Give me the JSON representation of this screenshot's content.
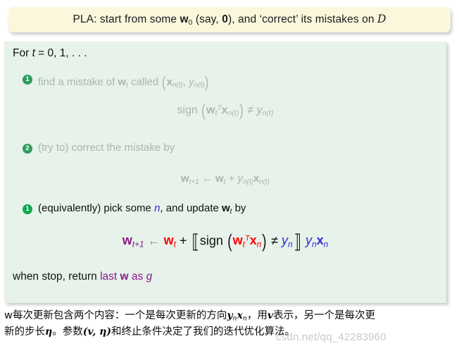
{
  "title": {
    "prefix": "PLA: start from some ",
    "w0": "w",
    "w0_sub": "0",
    "middle": " (say, ",
    "zero": "0",
    "after": "), and ‘correct’ its mistakes on ",
    "dataset": "D",
    "full_text": "PLA: start from some w0 (say, 0), and ‘correct’ its mistakes on D"
  },
  "algorithm": {
    "for_line": {
      "for": "For ",
      "t": "t",
      "rest": " = 0, 1, . . ."
    },
    "steps": [
      {
        "badge": "1",
        "badge_state": "dim",
        "text_before": "find a mistake of ",
        "w": "w",
        "w_sub": "t",
        "text_after": " called ",
        "tuple": "(x",
        "tuple_sub1": "n(t)",
        "tuple_mid": ", y",
        "tuple_sub2": "n(t)",
        "tuple_end": ")",
        "full_text": "find a mistake of w_t called (x_n(t), y_n(t))"
      },
      {
        "badge": "2",
        "badge_state": "dim",
        "text": "(try to) correct the mistake by",
        "full_text": "(try to) correct the mistake by"
      },
      {
        "badge": "1",
        "badge_state": "lit",
        "text_before": "(equivalently) pick some ",
        "n": "n",
        "text_mid": ", and update ",
        "w": "w",
        "w_sub": "t",
        "text_after": " by",
        "full_text": "(equivalently) pick some n, and update w_t by"
      }
    ],
    "formulas": [
      {
        "id": "mistake-condition",
        "state": "dim",
        "latex": "sign(w_t^T x_n(t)) ≠ y_n(t)"
      },
      {
        "id": "update-rule-indexed",
        "state": "dim",
        "latex": "w_{t+1} ← w_t + y_n(t) x_n(t)"
      },
      {
        "id": "update-rule-indicator",
        "state": "lit",
        "latex": "w_{t+1} ← w_t + [[ sign(w_t^T x_n) ≠ y_n ]] y_n x_n"
      }
    ],
    "when_stop": {
      "prefix": "when stop, return ",
      "highlight_last": "last ",
      "highlight_w": "w",
      "highlight_as": " as ",
      "highlight_g": "g",
      "full_text": "when stop, return last w as g"
    }
  },
  "caption": {
    "line1": "w每次更新包含两个内容：一个是每次更新的方向",
    "line1_math": "yₙxₙ",
    "line1_mid": "，用",
    "line1_v": "v",
    "line1_end": "表示，另一个是每次更",
    "line2_start": "新的步长",
    "line2_eta": "η",
    "line2_mid": "。参数",
    "line2_params": "(v, η)",
    "line2_end": "和终止条件决定了我们的迭代优化算法。"
  },
  "watermark": {
    "text": "csdn.net/qq_42283960"
  },
  "colors": {
    "title_bg": "#fbf7dd",
    "content_bg": "#e6f2ea",
    "badge_dim": "#2f9e5e",
    "badge_lit": "#0fa84f",
    "dim_text": "#a9b5ad",
    "purple": "#8b1a8b",
    "red": "#fb0007",
    "blue": "#2b29d8",
    "black": "#111111",
    "watermark": "#c9c9cf"
  }
}
